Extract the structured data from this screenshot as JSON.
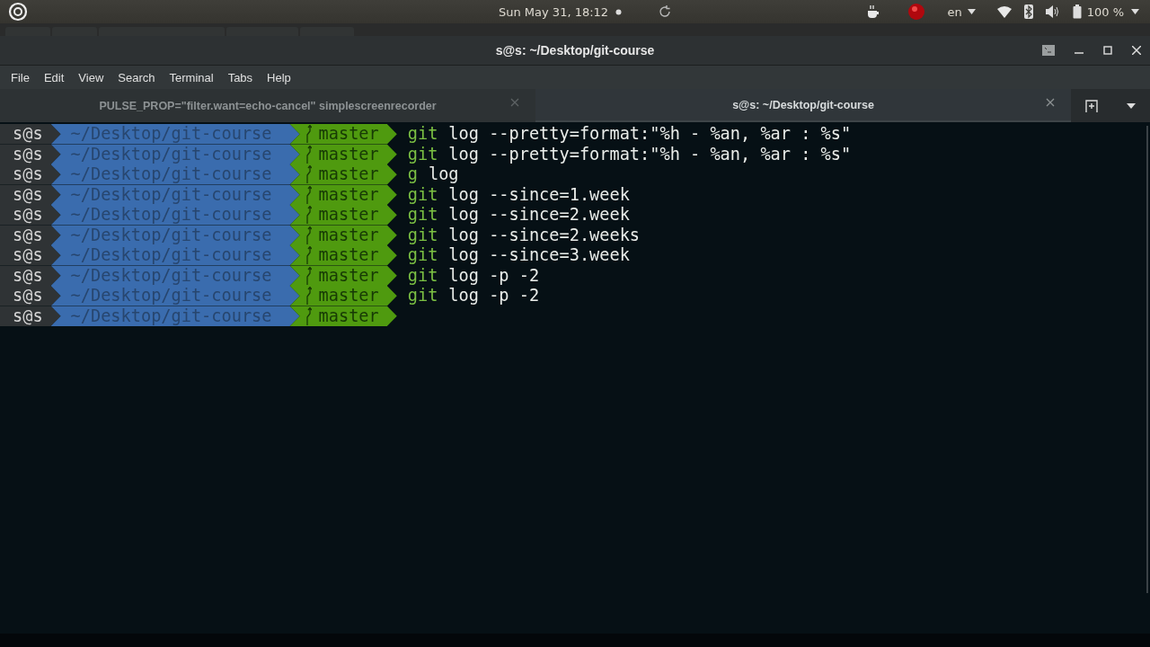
{
  "top_panel": {
    "clock": "Sun May 31, 18:12",
    "language": "en",
    "battery": "100 %"
  },
  "window": {
    "title": "s@s: ~/Desktop/git-course"
  },
  "menu": [
    "File",
    "Edit",
    "View",
    "Search",
    "Terminal",
    "Tabs",
    "Help"
  ],
  "tabs": [
    {
      "label": "PULSE_PROP=\"filter.want=echo-cancel\" simplescreenrecorder",
      "selected": false
    },
    {
      "label": "s@s: ~/Desktop/git-course",
      "selected": true
    }
  ],
  "terminal": {
    "lines": [
      {
        "user": "s@s",
        "path": "~/Desktop/git-course",
        "branch": "master",
        "program": "git",
        "arguments": "log --pretty=format:\"%h - %an, %ar : %s\""
      },
      {
        "user": "s@s",
        "path": "~/Desktop/git-course",
        "branch": "master",
        "program": "git",
        "arguments": "log --pretty=format:\"%h - %an, %ar : %s\""
      },
      {
        "user": "s@s",
        "path": "~/Desktop/git-course",
        "branch": "master",
        "program": "g",
        "arguments": "log"
      },
      {
        "user": "s@s",
        "path": "~/Desktop/git-course",
        "branch": "master",
        "program": "git",
        "arguments": "log --since=1.week"
      },
      {
        "user": "s@s",
        "path": "~/Desktop/git-course",
        "branch": "master",
        "program": "git",
        "arguments": "log --since=2.week"
      },
      {
        "user": "s@s",
        "path": "~/Desktop/git-course",
        "branch": "master",
        "program": "git",
        "arguments": "log --since=2.weeks"
      },
      {
        "user": "s@s",
        "path": "~/Desktop/git-course",
        "branch": "master",
        "program": "git",
        "arguments": "log --since=3.week"
      },
      {
        "user": "s@s",
        "path": "~/Desktop/git-course",
        "branch": "master",
        "program": "git",
        "arguments": "log -p -2"
      },
      {
        "user": "s@s",
        "path": "~/Desktop/git-course",
        "branch": "master",
        "program": "git",
        "arguments": "log -p -2"
      },
      {
        "user": "s@s",
        "path": "~/Desktop/git-course",
        "branch": "master"
      }
    ]
  }
}
